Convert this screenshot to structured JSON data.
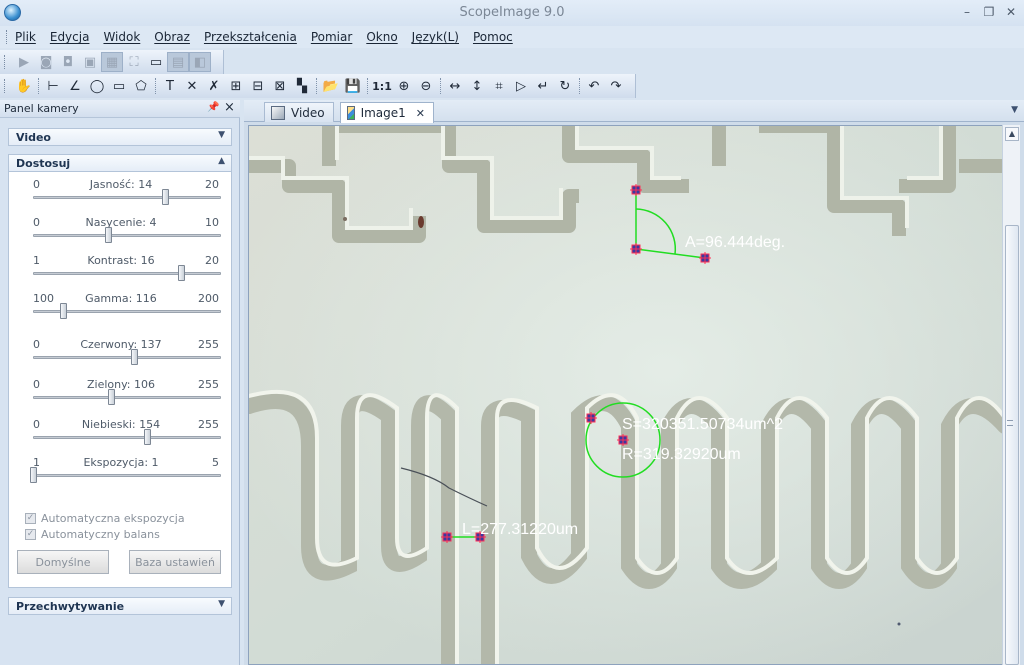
{
  "window": {
    "title": "ScopeImage 9.0",
    "minimize_glyph": "–",
    "restore_glyph": "❐",
    "close_glyph": "✕"
  },
  "menu": [
    "Plik",
    "Edycja",
    "Widok",
    "Obraz",
    "Przekształcenia",
    "Pomiar",
    "Okno",
    "Język(L)",
    "Pomoc"
  ],
  "toolbar2_text": {
    "one_to_one": "1:1",
    "text_tool": "T"
  },
  "panel": {
    "title": "Panel kamery",
    "groups": {
      "video": "Video",
      "adjust": "Dostosuj",
      "capture": "Przechwytywanie"
    },
    "sliders": [
      {
        "label": "Jasność: 14",
        "min": "0",
        "max": "20",
        "value": 14,
        "range": [
          0,
          20
        ]
      },
      {
        "label": "Nasycenie: 4",
        "min": "0",
        "max": "10",
        "value": 4,
        "range": [
          0,
          10
        ]
      },
      {
        "label": "Kontrast: 16",
        "min": "1",
        "max": "20",
        "value": 16,
        "range": [
          1,
          20
        ]
      },
      {
        "label": "Gamma: 116",
        "min": "100",
        "max": "200",
        "value": 116,
        "range": [
          100,
          200
        ]
      },
      {
        "label": "Czerwony: 137",
        "min": "0",
        "max": "255",
        "value": 137,
        "range": [
          0,
          255
        ]
      },
      {
        "label": "Zielony: 106",
        "min": "0",
        "max": "255",
        "value": 106,
        "range": [
          0,
          255
        ]
      },
      {
        "label": "Niebieski: 154",
        "min": "0",
        "max": "255",
        "value": 154,
        "range": [
          0,
          255
        ]
      },
      {
        "label": "Ekspozycja: 1",
        "min": "1",
        "max": "5",
        "value": 1,
        "range": [
          1,
          5
        ]
      }
    ],
    "checkboxes": [
      {
        "label": "Automatyczna ekspozycja",
        "checked": true
      },
      {
        "label": "Automatyczny balans",
        "checked": true
      }
    ],
    "buttons": {
      "defaults": "Domyślne",
      "settings_base": "Baza ustawień"
    }
  },
  "tabs": [
    {
      "label": "Video"
    },
    {
      "label": "Image1"
    }
  ],
  "measurements": {
    "angle": "A=96.444deg.",
    "area": "S=320351.50734um^2",
    "radius": "R=319.32920um",
    "length": "L=277.31220um"
  },
  "colors": {
    "measure_line": "#22dd22",
    "measure_text": "#ffffff",
    "marker_fill": "#3a3aa0",
    "marker_cross": "#ff2d55"
  }
}
